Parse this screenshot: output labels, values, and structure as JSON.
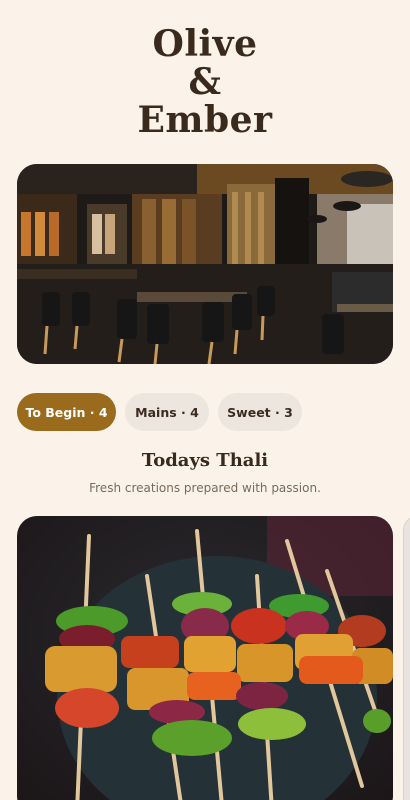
{
  "brand": {
    "line1": "Olive",
    "line2": "&",
    "line3": "Ember"
  },
  "tabs": [
    {
      "label": "To Begin · 4",
      "active": true
    },
    {
      "label": "Mains · 4",
      "active": false
    },
    {
      "label": "Sweet · 3",
      "active": false
    }
  ],
  "section": {
    "title": "Todays Thali",
    "subtitle": "Fresh creations prepared with passion."
  },
  "colors": {
    "background": "#fbf3ea",
    "accent": "#9a6b1d",
    "chip_inactive": "#ede6de"
  }
}
